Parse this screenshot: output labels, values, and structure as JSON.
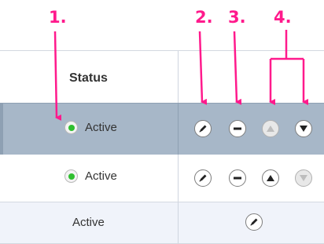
{
  "annotations": [
    "1.",
    "2.",
    "3.",
    "4."
  ],
  "table": {
    "column_header": "Status",
    "rows": [
      {
        "status": "Active",
        "has_radio": true,
        "selected": true,
        "actions": [
          "edit",
          "deactivate",
          "move-up",
          "move-down"
        ]
      },
      {
        "status": "Active",
        "has_radio": true,
        "actions": [
          "edit",
          "deactivate",
          "move-up",
          "move-down"
        ]
      },
      {
        "status": "Active",
        "has_radio": false,
        "actions": [
          "edit"
        ]
      }
    ]
  },
  "colors": {
    "annotation": "#ff1a8c",
    "selected_row": "#a7b7c8",
    "radio_dot": "#2fbf2f"
  }
}
